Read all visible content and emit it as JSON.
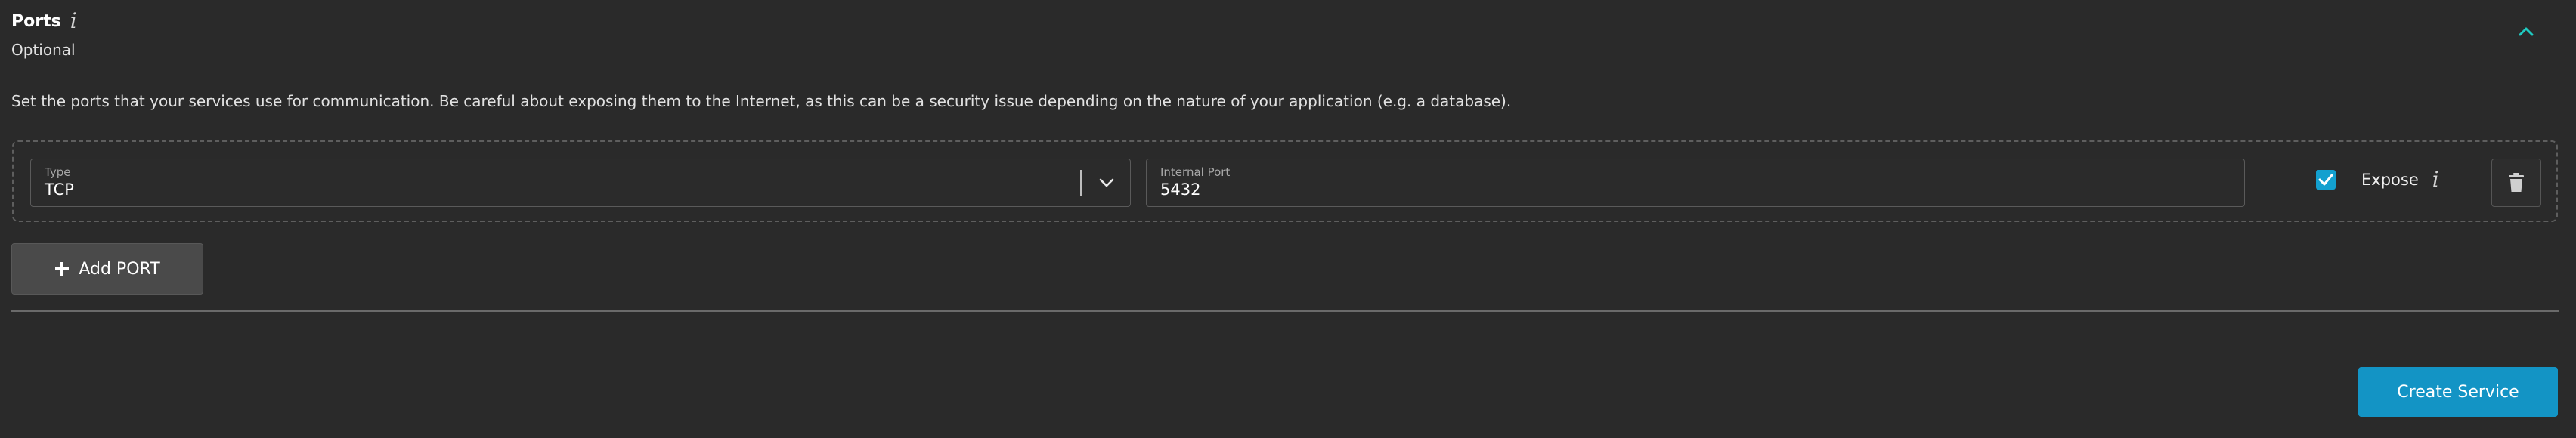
{
  "section": {
    "title": "Ports",
    "subtitle": "Optional",
    "description": "Set the ports that your services use for communication. Be careful about exposing them to the Internet, as this can be a security issue depending on the nature of your application (e.g. a database).",
    "info_glyph": "i",
    "collapse_icon": "chevron-up-icon"
  },
  "port_row": {
    "type_label": "Type",
    "type_value": "TCP",
    "internal_port_label": "Internal Port",
    "internal_port_value": "5432",
    "expose_label": "Expose",
    "expose_checked": true,
    "delete_icon": "trash-icon"
  },
  "actions": {
    "add_port_label": "Add PORT",
    "create_label": "Create Service"
  },
  "colors": {
    "background": "#2a2a2a",
    "accent_cyan": "#1fc9c0",
    "checkbox": "#13a0cf",
    "primary_button": "#1394c5",
    "secondary_button": "#4a4a4a"
  }
}
